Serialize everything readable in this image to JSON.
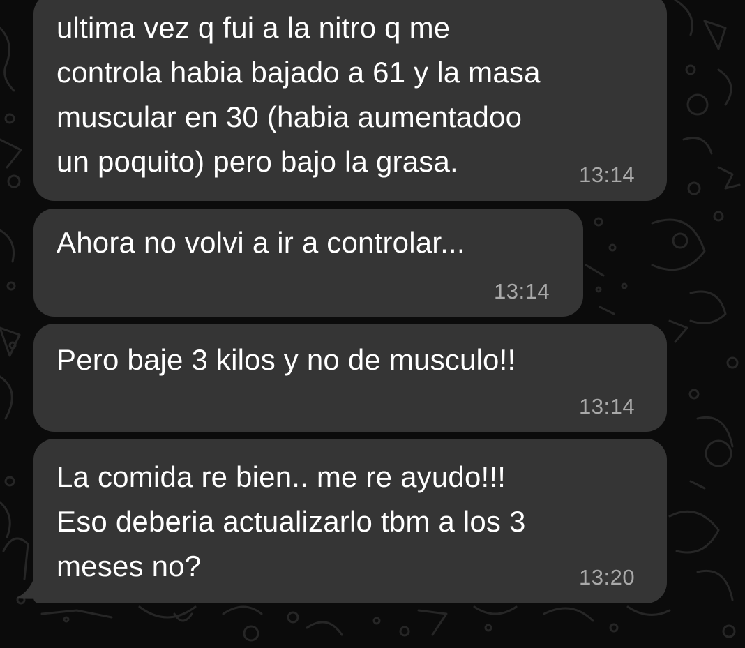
{
  "chat": {
    "messages": [
      {
        "lines": [
          "ultima vez q fui a la nitro q me",
          "controla habia bajado a 61 y la masa",
          "muscular en 30 (habia aumentadoo",
          "un poquito) pero bajo la grasa."
        ],
        "time": "13:14"
      },
      {
        "lines": [
          "Ahora no volvi a ir a controlar..."
        ],
        "time": "13:14"
      },
      {
        "lines": [
          "Pero baje 3 kilos y no de musculo!!"
        ],
        "time": "13:14"
      },
      {
        "lines": [
          "La comida re bien.. me re ayudo!!!",
          "Eso deberia actualizarlo tbm a los 3",
          "meses no?"
        ],
        "time": "13:20"
      }
    ]
  },
  "colors": {
    "background": "#0b0b0b",
    "bubble": "#353535",
    "text": "#ffffff",
    "timestamp": "#a9a9a9",
    "wallpaper_doodle": "#2a2a2a"
  },
  "icons": [
    "wallpaper-doodle-pattern"
  ]
}
